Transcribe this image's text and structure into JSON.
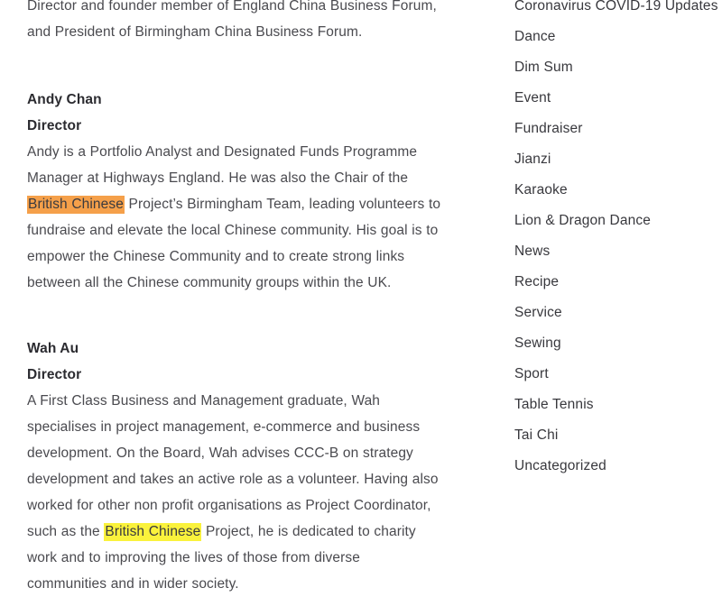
{
  "article": {
    "intro_paragraph": {
      "line1": "Director and founder member of England China Business Forum,",
      "line2": "and President of Birmingham China Business Forum."
    },
    "people": [
      {
        "name": "Andy Chan",
        "role": "Director",
        "bio_part1": "Andy is a Portfolio Analyst and Designated Funds Programme Manager at Highways England. He was also the Chair of the ",
        "bio_highlight": "British Chinese",
        "bio_highlight_style": "orange",
        "bio_part2": " Project’s Birmingham Team, leading volunteers to fundraise and elevate the local Chinese community. His goal is to empower the Chinese Community and to create strong links between all the Chinese community groups within the UK."
      },
      {
        "name": "Wah Au",
        "role": "Director",
        "bio_part1": "A First Class Business and Management graduate, Wah specialises in project management, e-commerce and business development.  On the Board, Wah advises CCC-B on strategy development and takes an active role as a volunteer.  Having also worked for other non profit organisations as Project Coordinator, such as the ",
        "bio_highlight": "British Chinese",
        "bio_highlight_style": "yellow",
        "bio_part2": " Project, he is dedicated to charity work and to improving the lives of those from diverse communities and in wider society."
      }
    ]
  },
  "sidebar": {
    "categories": [
      {
        "label": "Coronavirus COVID-19 Updates"
      },
      {
        "label": "Dance"
      },
      {
        "label": "Dim Sum"
      },
      {
        "label": "Event"
      },
      {
        "label": "Fundraiser"
      },
      {
        "label": "Jianzi"
      },
      {
        "label": "Karaoke"
      },
      {
        "label": "Lion & Dragon Dance"
      },
      {
        "label": "News"
      },
      {
        "label": "Recipe"
      },
      {
        "label": "Service"
      },
      {
        "label": "Sewing"
      },
      {
        "label": "Sport"
      },
      {
        "label": "Table Tennis"
      },
      {
        "label": "Tai Chi"
      },
      {
        "label": "Uncategorized"
      }
    ]
  },
  "colors": {
    "highlight_orange": "#f5a04a",
    "highlight_yellow": "#faf23c",
    "body_text": "#4a4a4f",
    "heading_text": "#2b2b30",
    "sidebar_text": "#38383d",
    "background": "#ffffff"
  }
}
